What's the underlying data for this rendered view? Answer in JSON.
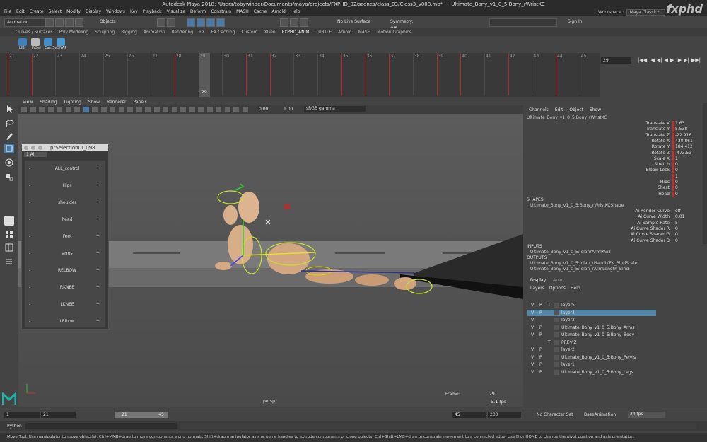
{
  "window": {
    "title": "Autodesk Maya 2018: /Users/tobywinder/Documents/maya/projects/FXPHD_02/scenes/class_03/Class3_v008.mb*  ---  Ultimate_Bony_v1_0_5:Bony_rWristKC",
    "menus": [
      "File",
      "Edit",
      "Create",
      "Select",
      "Modify",
      "Display",
      "Windows",
      "Key",
      "Playback",
      "Visualize",
      "Deform",
      "Constrain",
      "MASH",
      "Cache",
      "Arnold",
      "Help"
    ],
    "workspace_label": "Workspace :",
    "workspace_value": "Maya Classic*",
    "brand": "fxphd"
  },
  "statusline": {
    "mode": "Animation",
    "objects": "Objects",
    "live_surface": "No Live Surface",
    "symmetry": "Symmetry: Off",
    "sign_in": "Sign In"
  },
  "shelf": {
    "tabs": [
      "Curves / Surfaces",
      "Poly Modeling",
      "Sculpting",
      "Rigging",
      "Animation",
      "Rendering",
      "FX",
      "FX Caching",
      "Custom",
      "XGen",
      "FXPHD_ANIM",
      "TURTLE",
      "Arnold",
      "MASH",
      "Motion Graphics"
    ],
    "active_tab": "FXPHD_ANIM",
    "buttons": [
      {
        "label": "LIB",
        "color": "#3f7fbf"
      },
      {
        "label": "PrSel",
        "color": "#bbbbbb"
      },
      {
        "label": "CamSw",
        "color": "#3f8fcf"
      },
      {
        "label": "SNAP",
        "color": "#4a9ad8"
      }
    ]
  },
  "timeline": {
    "ticks": [
      "21",
      "22",
      "23",
      "24",
      "25",
      "26",
      "27",
      "28",
      "29",
      "30",
      "31",
      "32",
      "33",
      "34",
      "35",
      "36",
      "37",
      "38",
      "39",
      "40",
      "41",
      "42",
      "43",
      "44",
      "45"
    ],
    "current_frame_label": "29",
    "current_frame_field": "29",
    "keyframes": [
      21,
      22,
      28,
      31,
      32,
      35,
      36,
      37,
      39,
      40,
      42,
      44
    ]
  },
  "viewport": {
    "menus": [
      "View",
      "Shading",
      "Lighting",
      "Show",
      "Renderer",
      "Panels"
    ],
    "near_value": "0.00",
    "far_value": "1.00",
    "colorspace": "sRGB gamma",
    "camera": "persp",
    "frame_label": "Frame:",
    "frame_value": "29",
    "fps": "5.1 fps"
  },
  "selection_ui": {
    "title": "prSelectionUI_098",
    "dropdown": "1 All",
    "items": [
      "ALL_control",
      "Hips",
      "shoulder",
      "head",
      "Feet",
      "arms",
      "RELBOW",
      "RKNEE",
      "LKNEE",
      "LElbow"
    ],
    "minus": "-",
    "plus": "+"
  },
  "channel_box": {
    "menus": [
      "Channels",
      "Edit",
      "Object",
      "Show"
    ],
    "object": "Ultimate_Bony_v1_0_5:Bony_rWristKC",
    "attributes": [
      {
        "name": "Translate X",
        "value": "1.63",
        "key": "#c03030"
      },
      {
        "name": "Translate Y",
        "value": "5.538",
        "key": "#c03030"
      },
      {
        "name": "Translate Z",
        "value": "-22.916",
        "key": "#c03030"
      },
      {
        "name": "Rotate X",
        "value": "430.861",
        "key": "#c03030"
      },
      {
        "name": "Rotate Y",
        "value": "184.412",
        "key": "#c03030"
      },
      {
        "name": "Rotate Z",
        "value": "-473.53",
        "key": "#c03030"
      },
      {
        "name": "Scale X",
        "value": "1",
        "key": "#c03030"
      },
      {
        "name": "Stretch",
        "value": "0",
        "key": "#c03030"
      },
      {
        "name": "Elbow Lock",
        "value": "0",
        "key": "#c03030"
      },
      {
        "name": "",
        "value": "1",
        "key": "#c03030"
      },
      {
        "name": "Hips",
        "value": "0",
        "key": "#c03030"
      },
      {
        "name": "Chest",
        "value": "0",
        "key": "#c03030"
      },
      {
        "name": "Head",
        "value": "0",
        "key": "#c03030"
      }
    ],
    "shapes_label": "SHAPES",
    "shape_name": "Ultimate_Bony_v1_0_5:Bony_rWristKCShape",
    "shape_attrs": [
      {
        "name": "Ai Render Curve",
        "value": "off"
      },
      {
        "name": "Ai Curve Width",
        "value": "0.01"
      },
      {
        "name": "Ai Sample Rate",
        "value": "5"
      },
      {
        "name": "Ai Curve Shader R",
        "value": "0"
      },
      {
        "name": "Ai Curve Shader G",
        "value": "0"
      },
      {
        "name": "Ai Curve Shader B",
        "value": "0"
      }
    ],
    "inputs_label": "INPUTS",
    "inputs": [
      "Ultimate_Bony_v1_0_5:JolanrArmIKViz"
    ],
    "outputs_label": "OUTPUTS",
    "outputs": [
      "Ultimate_Bony_v1_0_5:Jolan_rHandIKFK_BlndScale",
      "Ultimate_Bony_v1_0_5:Jolan_rArmLength_Blnd"
    ],
    "side_tabs": [
      "Channel Box / Layer Editor",
      "Modeling Toolkit",
      "Attribute Editor"
    ]
  },
  "layer_editor": {
    "tabs": [
      "Display",
      "Anim"
    ],
    "menus": [
      "Layers",
      "Options",
      "Help"
    ],
    "layers": [
      {
        "v": "V",
        "p": "P",
        "t": "T",
        "name": "layer5",
        "selected": false
      },
      {
        "v": "V",
        "p": "P",
        "t": "",
        "name": "layer4",
        "selected": true
      },
      {
        "v": "V",
        "p": "",
        "t": "",
        "name": "layer3",
        "selected": false
      },
      {
        "v": "V",
        "p": "P",
        "t": "",
        "name": "Ultimate_Bony_v1_0_5:Bony_Arms",
        "selected": false
      },
      {
        "v": "V",
        "p": "P",
        "t": "",
        "name": "Ultimate_Bony_v1_0_5:Bony_Body",
        "selected": false
      },
      {
        "v": "",
        "p": "",
        "t": "T",
        "name": "PREVIZ",
        "selected": false
      },
      {
        "v": "V",
        "p": "P",
        "t": "",
        "name": "layer2",
        "selected": false
      },
      {
        "v": "V",
        "p": "P",
        "t": "",
        "name": "Ultimate_Bony_v1_0_5:Bony_Pelvis",
        "selected": false
      },
      {
        "v": "V",
        "p": "P",
        "t": "",
        "name": "layer1",
        "selected": false
      },
      {
        "v": "V",
        "p": "P",
        "t": "",
        "name": "Ultimate_Bony_v1_0_5:Bony_Legs",
        "selected": false
      }
    ]
  },
  "range": {
    "start": "1",
    "range_start": "21",
    "slider_start": "21",
    "slider_end": "45",
    "range_end": "45",
    "end": "200",
    "character": "No Character Set",
    "anim_layer": "BaseAnimation",
    "fps": "24 fps"
  },
  "command_line": {
    "language": "Python"
  },
  "help_line": "Move Tool: Use manipulator to move object(s). Ctrl+MMB+drag to move components along normals. Shift+drag manipulator axis or plane handles to extrude components or clone objects. Ctrl+Shift+LMB+drag to constrain movement to a connected edge. Use D or HOME to change the pivot position and axis orientation."
}
